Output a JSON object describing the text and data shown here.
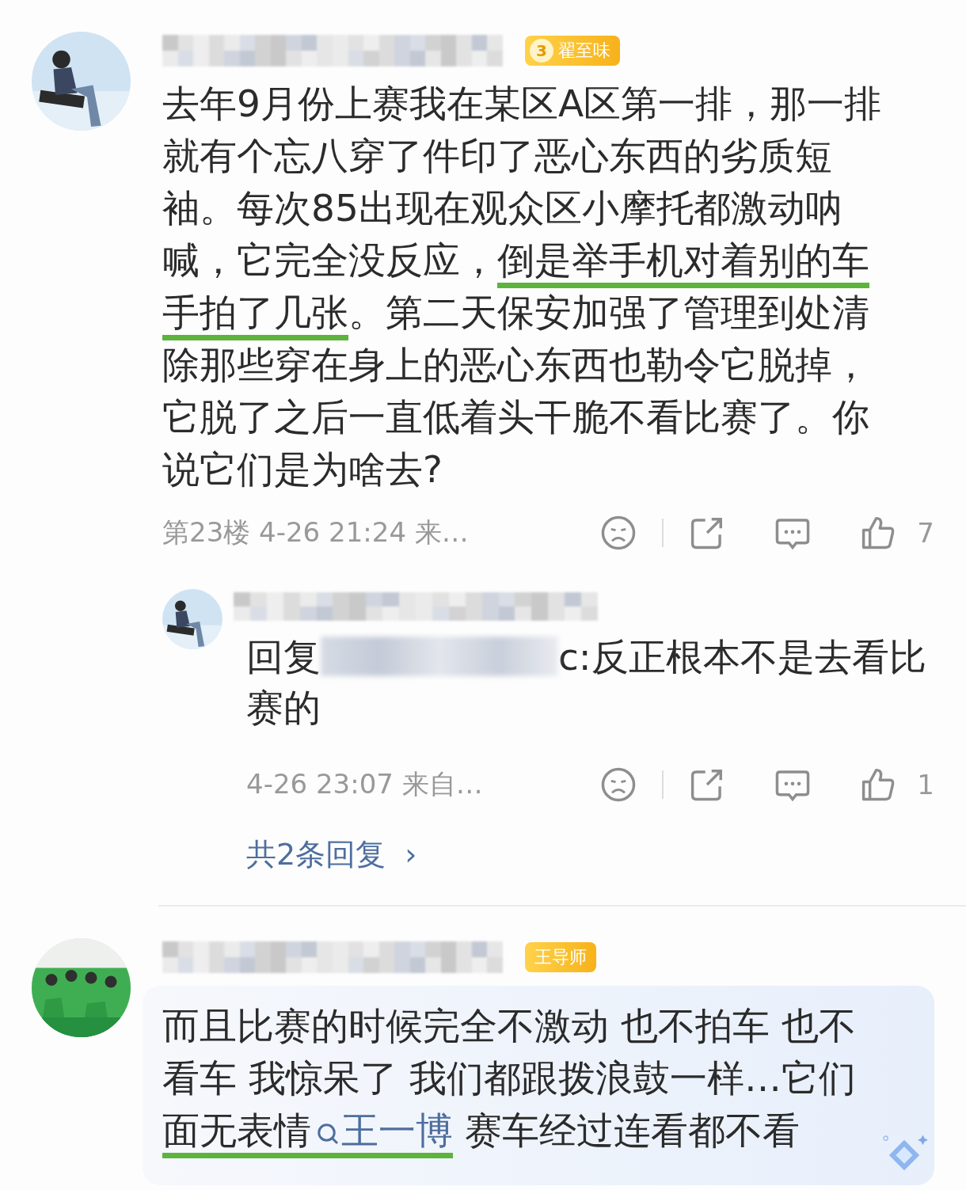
{
  "comments": [
    {
      "badge": {
        "kind": "level",
        "level": "3",
        "label": "翟至味"
      },
      "body": [
        {
          "kind": "text",
          "text": "去年9月份上赛我在某区A区第一排，那一排就有个忘八穿了件印了恶心东西的劣质短袖。每次85出现在观众区小摩托都激动呐喊，它完全没反应，",
          "underlined": false
        },
        {
          "kind": "text",
          "text": "倒是举手机对着别的车手拍了几张",
          "underlined": true
        },
        {
          "kind": "text",
          "text": "。第二天保安加强了管理到处清除那些穿在身上的恶心东西也勒令它脱掉，它脱了之后一直低着头干脆不看比赛了。你说它们是为啥去?",
          "underlined": false
        }
      ],
      "meta": "第23楼 4-26 21:24 来…",
      "likes": "7",
      "replies": [
        {
          "body": [
            {
              "kind": "text",
              "text": "回复",
              "underlined": false
            },
            {
              "kind": "redacted"
            },
            {
              "kind": "text",
              "text": "c:反正根本不是去看比赛的",
              "underlined": false
            }
          ],
          "meta": "4-26 23:07 来自…",
          "likes": "1"
        }
      ],
      "more_replies": {
        "label": "共2条回复",
        "arrow": "›"
      }
    },
    {
      "badge": {
        "kind": "plain",
        "label": "王导师"
      },
      "highlighted": true,
      "body": [
        {
          "kind": "text",
          "text": "而且比赛的时候完全不激动 也不拍车 也不看车 我惊呆了 我们都跟拨浪鼓一样…它们",
          "underlined": false
        },
        {
          "kind": "text",
          "text": "面无表情",
          "underlined": true
        },
        {
          "kind": "mention",
          "text": "王一博",
          "underlined": true
        },
        {
          "kind": "text",
          "text": " 赛车经过连看都不看",
          "underlined": false
        }
      ]
    }
  ]
}
